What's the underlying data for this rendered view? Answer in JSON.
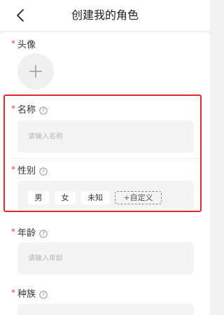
{
  "nav": {
    "title": "创建我的角色",
    "back_icon": "chevron-left-icon"
  },
  "fields": {
    "avatar": {
      "required_mark": "*",
      "label": "头像",
      "add_icon": "plus-icon"
    },
    "name": {
      "required_mark": "*",
      "label": "名称",
      "placeholder": "请输入名称",
      "value": ""
    },
    "gender": {
      "required_mark": "*",
      "label": "性别",
      "options": [
        "男",
        "女",
        "未知"
      ],
      "custom_label": "+自定义"
    },
    "age": {
      "required_mark": "*",
      "label": "年龄",
      "placeholder": "请输入年龄",
      "value": ""
    },
    "race": {
      "required_mark": "*",
      "label": "种族"
    }
  },
  "colors": {
    "required": "#e0433b",
    "highlight": "#e02c2c",
    "field_bg": "#f4f4f4",
    "page_bg": "#f2f2f2"
  }
}
